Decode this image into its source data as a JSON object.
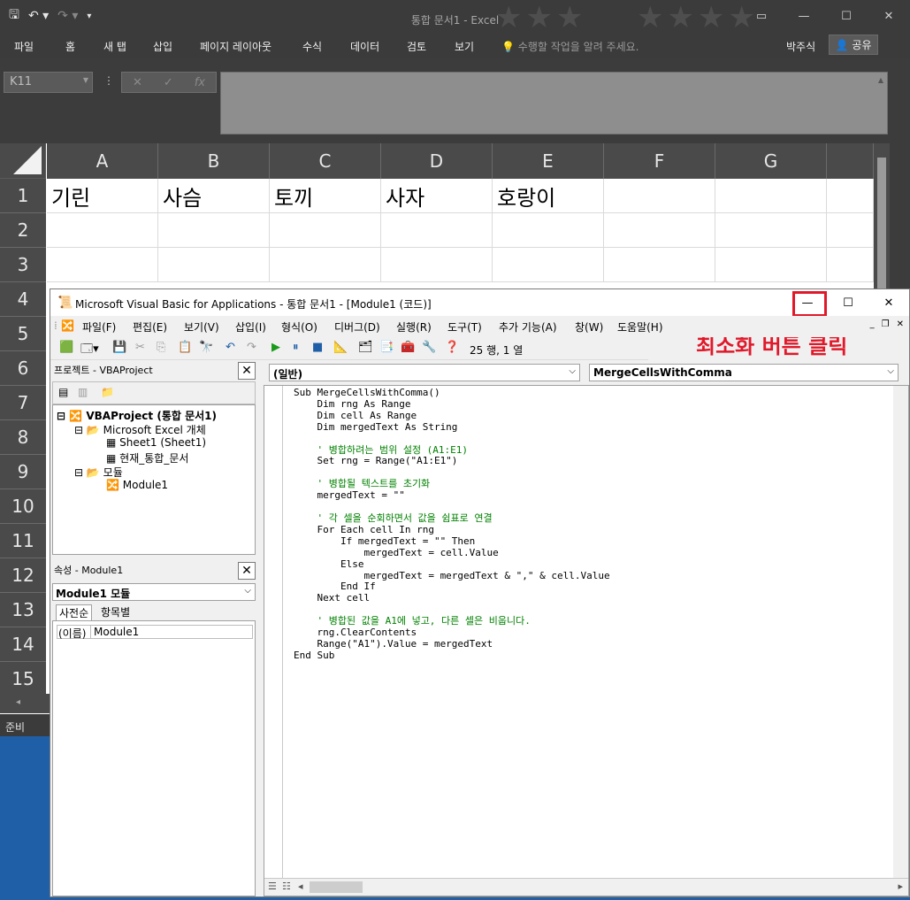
{
  "excel": {
    "title": "통합 문서1  -  Excel",
    "ribbon_tabs": [
      "파일",
      "홈",
      "새 탭",
      "삽입",
      "페이지 레이아웃",
      "수식",
      "데이터",
      "검토",
      "보기"
    ],
    "tell_me": "수행할 작업을 알려 주세요.",
    "user": "박주식",
    "share": "공유",
    "name_box": "K11",
    "columns": [
      "A",
      "B",
      "C",
      "D",
      "E",
      "F",
      "G"
    ],
    "rows": [
      "1",
      "2",
      "3",
      "4",
      "5",
      "6",
      "7",
      "8",
      "9",
      "10",
      "11",
      "12",
      "13",
      "14",
      "15"
    ],
    "row1_cells": [
      "기린",
      "사슴",
      "토끼",
      "사자",
      "호랑이"
    ],
    "status": "준비"
  },
  "vba": {
    "title": "Microsoft Visual Basic for Applications - 통합 문서1 - [Module1 (코드)]",
    "menus": [
      "파일(F)",
      "편집(E)",
      "보기(V)",
      "삽입(I)",
      "형식(O)",
      "디버그(D)",
      "실행(R)",
      "도구(T)",
      "추가 기능(A)",
      "창(W)",
      "도움말(H)"
    ],
    "cursor_position": "25 행, 1 열",
    "annotation": "최소화 버튼 클릭",
    "project_panel": {
      "title": "프로젝트 - VBAProject",
      "root": "VBAProject (통합 문서1)",
      "excel_objects": "Microsoft Excel 개체",
      "sheet1": "Sheet1 (Sheet1)",
      "thisworkbook": "현재_통합_문서",
      "modules": "모듈",
      "module1": "Module1"
    },
    "properties_panel": {
      "title": "속성 - Module1",
      "object": "Module1 모듈",
      "tab_alpha": "사전순",
      "tab_category": "항목별",
      "prop_name": "(이름)",
      "prop_value": "Module1"
    },
    "code": {
      "object_dropdown": "(일반)",
      "procedure_dropdown": "MergeCellsWithComma",
      "lines": [
        "Sub MergeCellsWithComma()",
        "    Dim rng As Range",
        "    Dim cell As Range",
        "    Dim mergedText As String",
        "",
        "    ' 병합하려는 범위 설정 (A1:E1)",
        "    Set rng = Range(\"A1:E1\")",
        "",
        "    ' 병합될 텍스트를 초기화",
        "    mergedText = \"\"",
        "",
        "    ' 각 셀을 순회하면서 값을 쉼표로 연결",
        "    For Each cell In rng",
        "        If mergedText = \"\" Then",
        "            mergedText = cell.Value",
        "        Else",
        "            mergedText = mergedText & \",\" & cell.Value",
        "        End If",
        "    Next cell",
        "",
        "    ' 병합된 값을 A1에 넣고, 다른 셀은 비웁니다.",
        "    rng.ClearContents",
        "    Range(\"A1\").Value = mergedText",
        "End Sub"
      ]
    }
  }
}
